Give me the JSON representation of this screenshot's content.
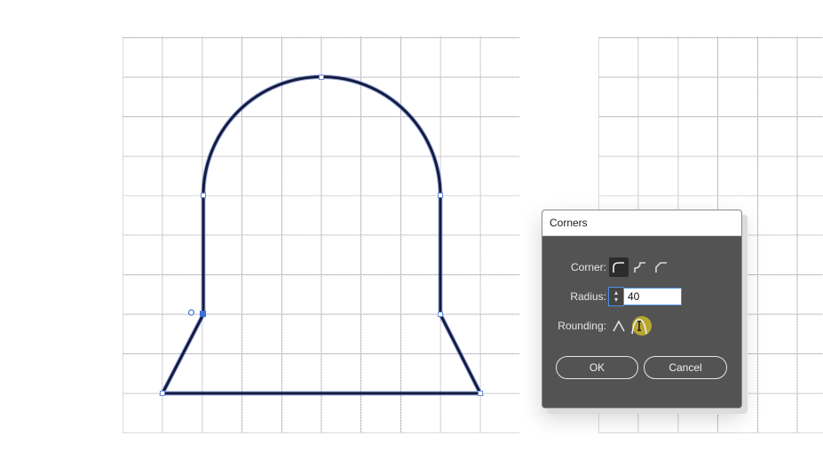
{
  "dialog": {
    "title": "Corners",
    "corner_label": "Corner:",
    "corner_options": [
      "round-corner-icon",
      "inverted-round-corner-icon",
      "chamfer-corner-icon"
    ],
    "corner_selected": 0,
    "radius_label": "Radius:",
    "radius_value": "40",
    "rounding_label": "Rounding:",
    "rounding_options": [
      "absolute-rounding-icon",
      "relative-rounding-icon"
    ],
    "ok_label": "OK",
    "cancel_label": "Cancel"
  },
  "colors": {
    "path_stroke": "#141b3d",
    "path_glow": "#4a67c9",
    "dialog_bg": "#535353",
    "input_focus": "#4a90e2",
    "cursor_highlight": "#c9b62a"
  }
}
